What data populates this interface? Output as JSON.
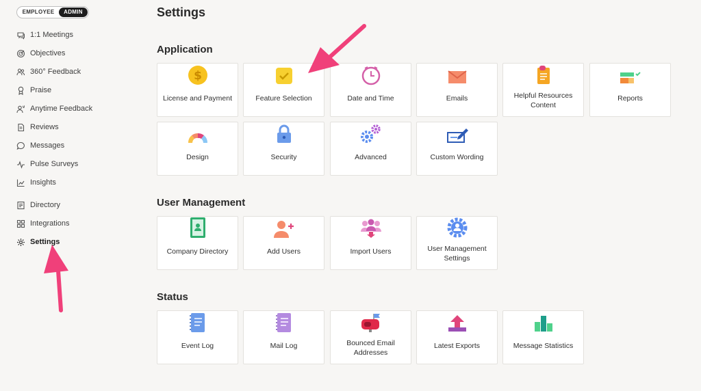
{
  "toggle": {
    "employee": "EMPLOYEE",
    "admin": "ADMIN"
  },
  "sidebar": {
    "items": [
      {
        "label": "1:1 Meetings",
        "icon": "chat-icon"
      },
      {
        "label": "Objectives",
        "icon": "target-icon"
      },
      {
        "label": "360° Feedback",
        "icon": "people-icon"
      },
      {
        "label": "Praise",
        "icon": "ribbon-icon"
      },
      {
        "label": "Anytime Feedback",
        "icon": "person-feedback-icon"
      },
      {
        "label": "Reviews",
        "icon": "document-icon"
      },
      {
        "label": "Messages",
        "icon": "message-icon"
      },
      {
        "label": "Pulse Surveys",
        "icon": "pulse-icon"
      },
      {
        "label": "Insights",
        "icon": "chart-icon"
      },
      {
        "label": "Directory",
        "icon": "directory-icon"
      },
      {
        "label": "Integrations",
        "icon": "grid-icon"
      },
      {
        "label": "Settings",
        "icon": "gear-icon"
      }
    ]
  },
  "page_title": "Settings",
  "sections": {
    "application": {
      "title": "Application",
      "cards": [
        "License and Payment",
        "Feature Selection",
        "Date and Time",
        "Emails",
        "Helpful Resources Content",
        "Reports",
        "Design",
        "Security",
        "Advanced",
        "Custom Wording"
      ]
    },
    "user_management": {
      "title": "User Management",
      "cards": [
        "Company Directory",
        "Add Users",
        "Import Users",
        "User Management Settings"
      ]
    },
    "status": {
      "title": "Status",
      "cards": [
        "Event Log",
        "Mail Log",
        "Bounced Email Addresses",
        "Latest Exports",
        "Message Statistics"
      ]
    }
  },
  "colors": {
    "accent_arrow": "#f0407a",
    "active_toggle": "#1d1d1d"
  }
}
